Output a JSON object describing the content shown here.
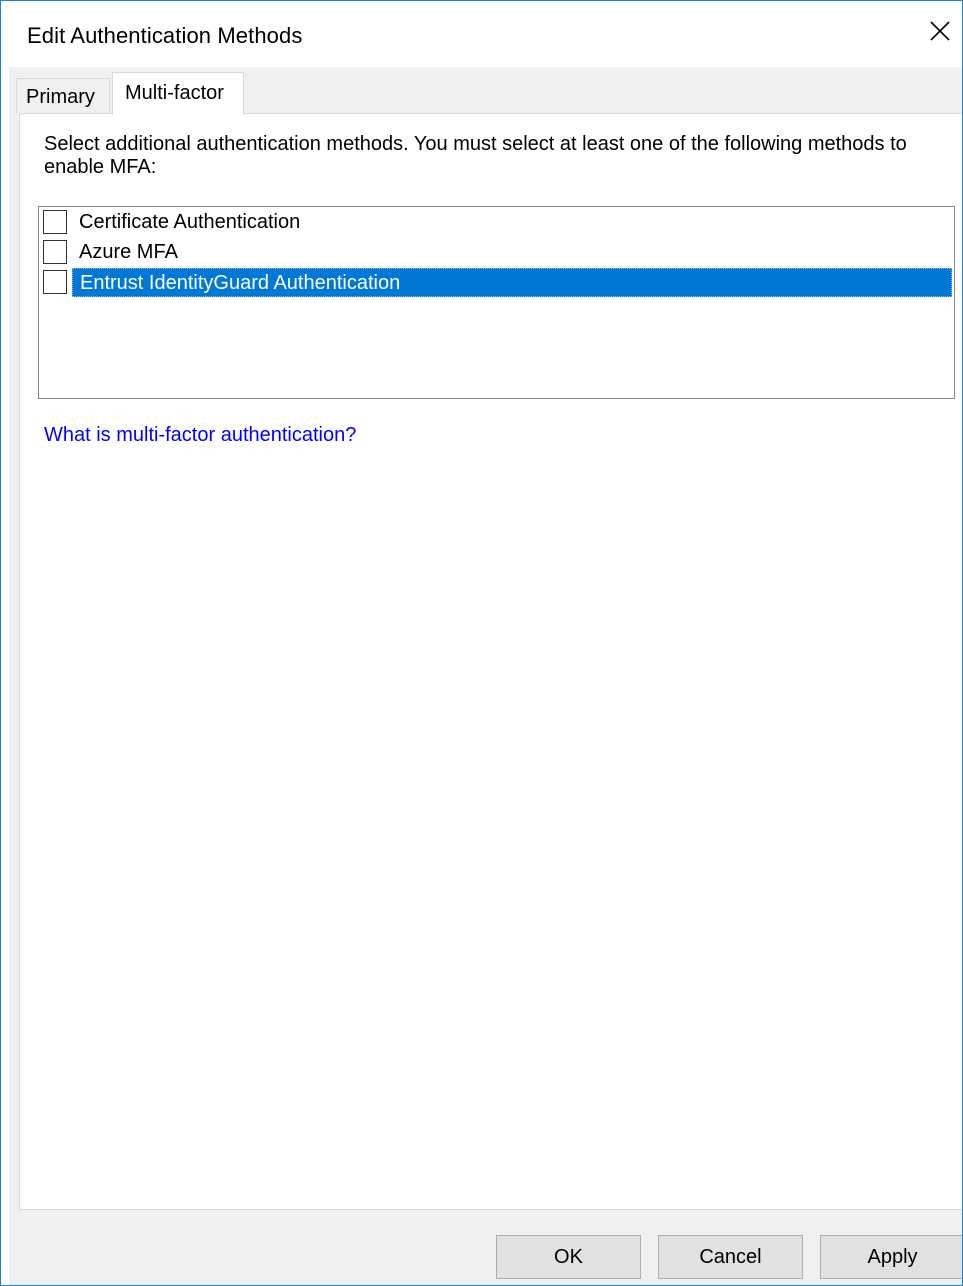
{
  "window": {
    "title": "Edit Authentication Methods",
    "close_icon": "close-icon"
  },
  "tabs": [
    {
      "label": "Primary",
      "active": false
    },
    {
      "label": "Multi-factor",
      "active": true
    }
  ],
  "panel": {
    "instructions": "Select additional authentication methods. You must select at least one of the following methods to enable MFA:",
    "methods": [
      {
        "label": "Certificate Authentication",
        "checked": false,
        "selected": false
      },
      {
        "label": "Azure MFA",
        "checked": false,
        "selected": false
      },
      {
        "label": "Entrust IdentityGuard Authentication",
        "checked": false,
        "selected": true
      }
    ],
    "help_link": "What is multi-factor authentication?"
  },
  "buttons": {
    "ok": "OK",
    "cancel": "Cancel",
    "apply": "Apply"
  },
  "colors": {
    "accent": "#0078d7",
    "window_border": "#1883d7",
    "link": "#0000ff",
    "dialog_background": "#f0f0f0"
  }
}
